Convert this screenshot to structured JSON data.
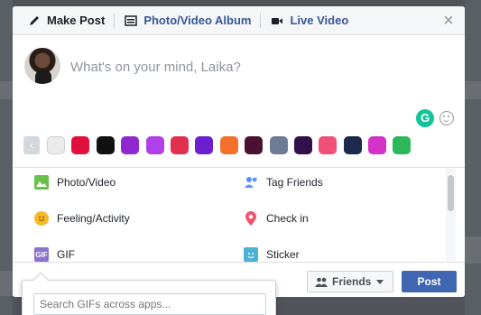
{
  "tabs": [
    {
      "label": "Make Post",
      "icon": "pencil-icon"
    },
    {
      "label": "Photo/Video Album",
      "icon": "album-icon"
    },
    {
      "label": "Live Video",
      "icon": "live-video-icon"
    }
  ],
  "composer": {
    "placeholder": "What's on your mind, Laika?"
  },
  "swatches": [
    "#ebebeb",
    "#e0103a",
    "#111111",
    "#9028d1",
    "#b041e8",
    "#e2304f",
    "#6b1fcf",
    "#f5702a",
    "#4a1230",
    "#6e7b94",
    "#30114a",
    "#f04f76",
    "#1e2a4d",
    "#d432c8",
    "#2cb85a"
  ],
  "options": [
    {
      "label": "Photo/Video",
      "icon": "photo-icon",
      "color": "#6bc04b"
    },
    {
      "label": "Tag Friends",
      "icon": "tag-friends-icon",
      "color": "#5890ff"
    },
    {
      "label": "Feeling/Activity",
      "icon": "feeling-icon",
      "color": "#f7b928"
    },
    {
      "label": "Check in",
      "icon": "checkin-icon",
      "color": "#f35369"
    },
    {
      "label": "GIF",
      "icon": "gif-icon",
      "color": "#8c72cb"
    },
    {
      "label": "Sticker",
      "icon": "sticker-icon",
      "color": "#4db2d5"
    }
  ],
  "footer": {
    "audience_label": "Friends",
    "post_label": "Post"
  },
  "gif_search": {
    "placeholder": "Search GIFs across apps..."
  },
  "grammarly_label": "G"
}
